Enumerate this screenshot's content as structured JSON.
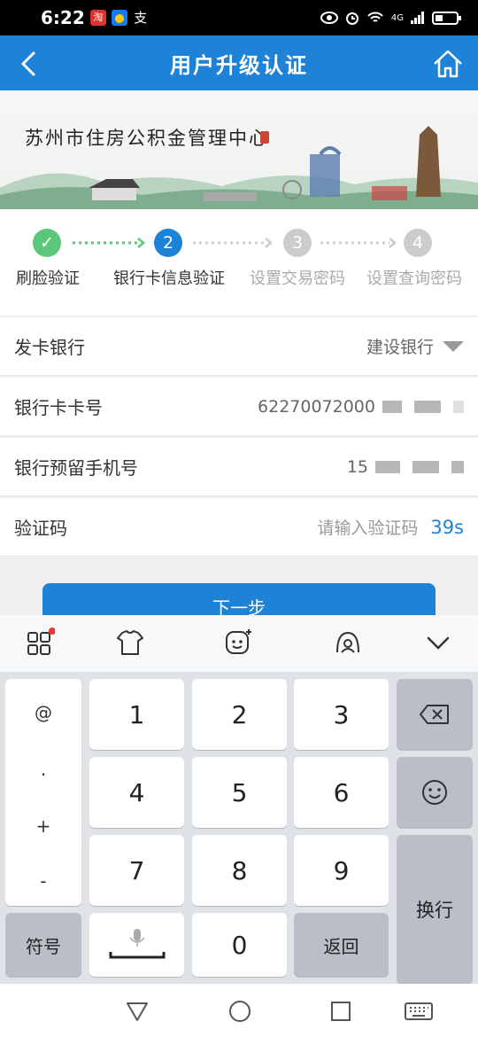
{
  "status": {
    "time": "6:22",
    "app1": "淘",
    "app2": "●",
    "app3": "支",
    "network": "4G"
  },
  "header": {
    "title": "用户升级认证"
  },
  "banner": {
    "title": "苏州市住房公积金管理中心"
  },
  "steps": [
    {
      "num": "✓",
      "label": "刷脸验证",
      "state": "done"
    },
    {
      "num": "2",
      "label": "银行卡信息验证",
      "state": "current"
    },
    {
      "num": "3",
      "label": "设置交易密码",
      "state": "todo"
    },
    {
      "num": "4",
      "label": "设置查询密码",
      "state": "todo"
    }
  ],
  "form": {
    "bank_label": "发卡银行",
    "bank_value": "建设银行",
    "card_label": "银行卡卡号",
    "card_value": "62270072000",
    "phone_label": "银行预留手机号",
    "phone_value": "15",
    "code_label": "验证码",
    "code_placeholder": "请输入验证码",
    "code_timer": "39s"
  },
  "next_button": "下一步",
  "keyboard": {
    "symbols": [
      "@",
      ".",
      "+",
      "-"
    ],
    "digits": [
      "1",
      "2",
      "3",
      "4",
      "5",
      "6",
      "7",
      "8",
      "9",
      "0"
    ],
    "fuhao": "符号",
    "back": "返回",
    "enter": "换行"
  },
  "colors": {
    "primary": "#1e82d6",
    "done": "#5cc67a",
    "inactive": "#cccccc"
  }
}
